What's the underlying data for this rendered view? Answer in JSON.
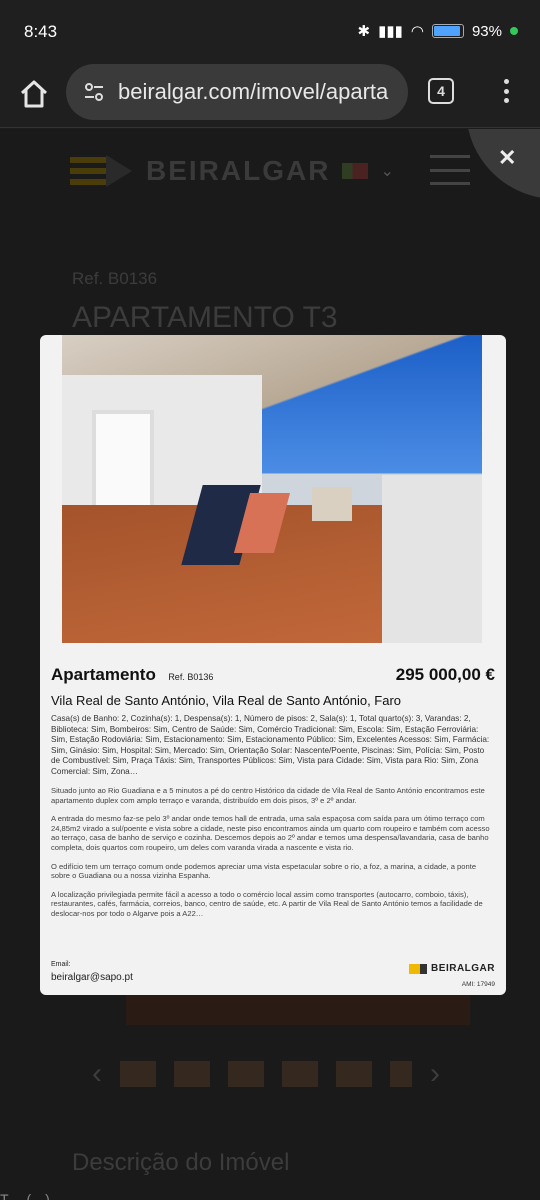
{
  "status": {
    "time": "8:43",
    "battery": "93",
    "battery_suffix": "%",
    "battery_level": 0.93
  },
  "browser": {
    "url": "beiralgar.com/imovel/aparta",
    "tab_count": "4"
  },
  "site": {
    "logo": "BEIRALGAR",
    "ref": "Ref. B0136",
    "title": "APARTAMENTO T3",
    "description_heading": "Descrição do Imóvel",
    "footer_partial": "T…        (…)"
  },
  "card": {
    "type": "Apartamento",
    "ref": "Ref. B0136",
    "price": "295 000,00 €",
    "location": "Vila Real de Santo António, Vila Real de Santo António, Faro",
    "features": "Casa(s) de Banho: 2, Cozinha(s): 1, Despensa(s): 1, Número de pisos: 2, Sala(s): 1, Total quarto(s): 3, Varandas: 2, Biblioteca: Sim, Bombeiros: Sim, Centro de Saúde: Sim, Comércio Tradicional: Sim, Escola: Sim, Estação Ferroviária: Sim, Estação Rodoviária: Sim, Estacionamento: Sim, Estacionamento Público: Sim, Excelentes Acessos: Sim, Farmácia: Sim, Ginásio: Sim, Hospital: Sim, Mercado: Sim, Orientação Solar: Nascente/Poente, Piscinas: Sim, Polícia: Sim, Posto de Combustível: Sim, Praça Táxis: Sim, Transportes Públicos: Sim, Vista para Cidade: Sim, Vista para Rio: Sim, Zona Comercial: Sim, Zona…",
    "desc1": "Situado junto ao Rio Guadiana e a 5 minutos a pé do centro Histórico da cidade de Vila Real de Santo António encontramos este apartamento duplex com amplo terraço e varanda, distribuído em dois pisos, 3º e 2º andar.",
    "desc2": "A entrada do mesmo faz-se pelo 3º andar onde temos hall de entrada, uma sala espaçosa com saída para um ótimo terraço com 24,85m2 virado a sul/poente e vista sobre a cidade, neste piso encontramos ainda um quarto com roupeiro e também com acesso ao terraço, casa de banho de serviço e cozinha. Descemos depois ao 2º andar e temos uma despensa/lavandaria, casa de banho completa, dois quartos com roupeiro, um deles com varanda virada a nascente e vista rio.",
    "desc3": "O edifício tem um terraço comum onde podemos apreciar uma vista espetacular sobre o rio, a foz, a marina, a cidade, a ponte sobre o Guadiana ou a nossa vizinha Espanha.",
    "desc4": "A localização privilegiada permite fácil a acesso a todo o comércio local assim como transportes (autocarro, comboio, táxis), restaurantes, cafés, farmácia, correios, banco, centro de saúde, etc. A partir de Vila Real de Santo António temos a facilidade de deslocar-nos por todo o Algarve pois a A22…",
    "email_label": "Email:",
    "email": "beiralgar@sapo.pt",
    "logo": "BEIRALGAR",
    "ami": "AMI: 17949"
  }
}
